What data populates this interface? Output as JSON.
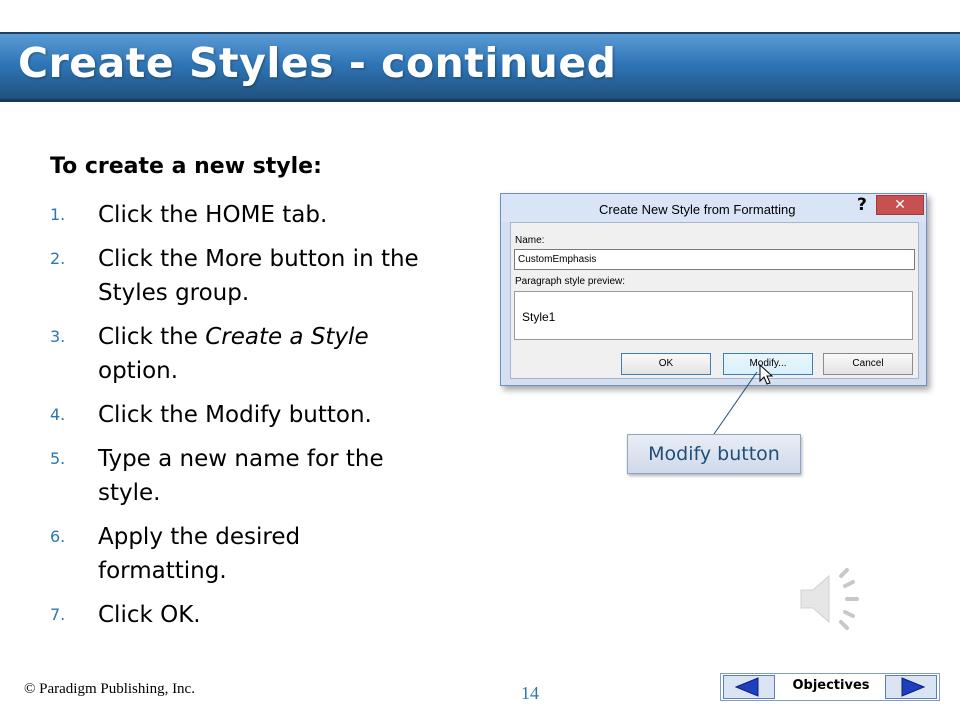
{
  "slide": {
    "title": "Create Styles - continued",
    "heading": "To create a new style:",
    "steps": [
      {
        "num": "1.",
        "text": "Click the HOME tab."
      },
      {
        "num": "2.",
        "text": "Click the More button in the Styles group."
      },
      {
        "num": "3.",
        "text_before": "Click the ",
        "text_italic": "Create a Style",
        "text_after": " option."
      },
      {
        "num": "4.",
        "text": "Click the Modify button."
      },
      {
        "num": "5.",
        "text": "Type a new name for the style."
      },
      {
        "num": "6.",
        "text": "Apply the desired formatting."
      },
      {
        "num": "7.",
        "text": "Click OK."
      }
    ]
  },
  "dialog": {
    "title": "Create New Style from Formatting",
    "help": "?",
    "close": "✕",
    "name_label": "Name:",
    "name_value": "CustomEmphasis",
    "preview_label": "Paragraph style preview:",
    "preview_text": "Style1",
    "buttons": {
      "ok": "OK",
      "modify": "Modify...",
      "cancel": "Cancel"
    }
  },
  "callout": {
    "label": "Modify button"
  },
  "footer": {
    "copyright": "© Paradigm Publishing, Inc.",
    "page": "14",
    "nav_label": "Objectives"
  },
  "colors": {
    "accent": "#2e75b6",
    "title_bar": "#1f4e79"
  }
}
